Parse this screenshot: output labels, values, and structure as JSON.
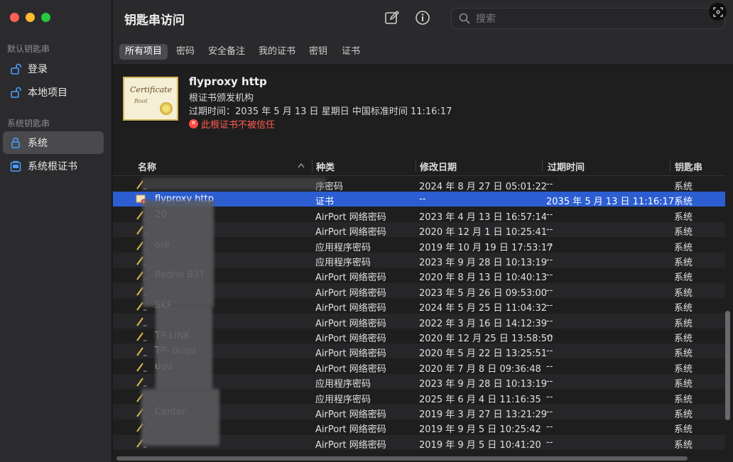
{
  "sidebar": {
    "default_section": "默认钥匙串",
    "system_section": "系统钥匙串",
    "items": [
      {
        "label": "登录"
      },
      {
        "label": "本地项目"
      },
      {
        "label": "系统"
      },
      {
        "label": "系统根证书"
      }
    ]
  },
  "header": {
    "title": "钥匙串访问",
    "search_placeholder": "搜索"
  },
  "tabs": [
    "所有项目",
    "密码",
    "安全备注",
    "我的证书",
    "密钥",
    "证书"
  ],
  "detail": {
    "name": "flyproxy http",
    "kind": "根证书颁发机构",
    "expiry": "过期时间：2035 年 5 月 13 日 星期日 中国标准时间 11:16:17",
    "warning": "此根证书不被信任",
    "cert_word": "Certificate",
    "cert_sub": "Root"
  },
  "table": {
    "columns": [
      "名称",
      "种类",
      "修改日期",
      "过期时间",
      "钥匙串"
    ],
    "rows": [
      {
        "name": "",
        "kind": "序密码",
        "modified": "2024 年 8 月 27 日 05:01:22",
        "expires": "--",
        "keychain": "系统",
        "icon": "pen"
      },
      {
        "name": "flyproxy http",
        "kind": "证书",
        "modified": "--",
        "expires": "2035 年 5 月 13 日 11:16:17",
        "keychain": "系统",
        "icon": "cert"
      },
      {
        "name": "20",
        "kind": "AirPort 网络密码",
        "modified": "2023 年 4 月 13 日 16:57:14",
        "expires": "--",
        "keychain": "系统",
        "icon": "pen"
      },
      {
        "name": "",
        "kind": "AirPort 网络密码",
        "modified": "2020 年 12 月 1 日 10:25:41",
        "expires": "--",
        "keychain": "系统",
        "icon": "pen"
      },
      {
        "name": "ore",
        "kind": "应用程序密码",
        "modified": "2019 年 10 月 19 日 17:53:17",
        "expires": "--",
        "keychain": "系统",
        "icon": "pen"
      },
      {
        "name": "",
        "kind": "应用程序密码",
        "modified": "2023 年 9 月 28 日 10:13:19",
        "expires": "--",
        "keychain": "系统",
        "icon": "pen"
      },
      {
        "name": "Redmi          B3T",
        "kind": "AirPort 网络密码",
        "modified": "2020 年 8 月 13 日 10:40:13",
        "expires": "--",
        "keychain": "系统",
        "icon": "pen"
      },
      {
        "name": "",
        "kind": "AirPort 网络密码",
        "modified": "2023 年 5 月 26 日 09:53:00",
        "expires": "--",
        "keychain": "系统",
        "icon": "pen"
      },
      {
        "name": "SKF",
        "kind": "AirPort 网络密码",
        "modified": "2024 年 5 月 25 日 11:04:32",
        "expires": "--",
        "keychain": "系统",
        "icon": "pen"
      },
      {
        "name": "",
        "kind": "AirPort 网络密码",
        "modified": "2022 年 3 月 16 日 14:12:39",
        "expires": "--",
        "keychain": "系统",
        "icon": "pen"
      },
      {
        "name": "TP-LINK",
        "kind": "AirPort 网络密码",
        "modified": "2020 年 12 月 25 日 13:58:50",
        "expires": "--",
        "keychain": "系统",
        "icon": "pen"
      },
      {
        "name": "TP-              ouqu",
        "kind": "AirPort 网络密码",
        "modified": "2020 年 5 月 22 日 13:25:51",
        "expires": "--",
        "keychain": "系统",
        "icon": "pen"
      },
      {
        "name": "               uqu",
        "kind": "AirPort 网络密码",
        "modified": "2020 年 7 月 8 日 09:36:48",
        "expires": "--",
        "keychain": "系统",
        "icon": "pen"
      },
      {
        "name": "",
        "kind": "应用程序密码",
        "modified": "2023 年 9 月 28 日 10:13:19",
        "expires": "--",
        "keychain": "系统",
        "icon": "pen"
      },
      {
        "name": "",
        "kind": "应用程序密码",
        "modified": "2025 年 6 月 4 日 11:16:35",
        "expires": "--",
        "keychain": "系统",
        "icon": "pen"
      },
      {
        "name": "                Center",
        "kind": "AirPort 网络密码",
        "modified": "2019 年 3 月 27 日 13:21:29",
        "expires": "--",
        "keychain": "系统",
        "icon": "pen"
      },
      {
        "name": "",
        "kind": "AirPort 网络密码",
        "modified": "2019 年 9 月 5 日 10:25:42",
        "expires": "--",
        "keychain": "系统",
        "icon": "pen"
      },
      {
        "name": "",
        "kind": "AirPort 网络密码",
        "modified": "2019 年 9 月 5 日 10:41:20",
        "expires": "--",
        "keychain": "系统",
        "icon": "pen"
      }
    ]
  },
  "colors": {
    "selection": "#2c5ed1",
    "warning": "#ff5b52",
    "sidebar_icon": "#4a9eff"
  }
}
